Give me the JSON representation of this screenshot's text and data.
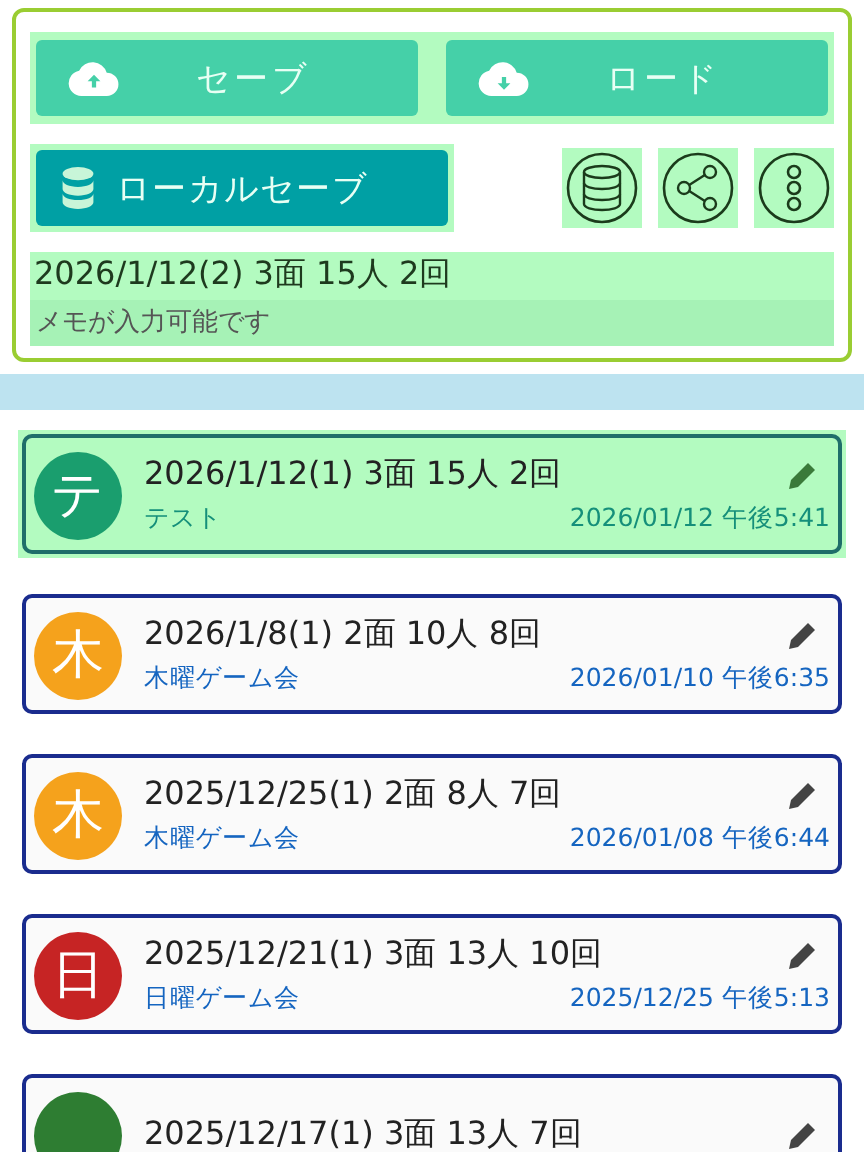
{
  "top_buttons": [
    {
      "label": "セーブ"
    },
    {
      "label": "ロード"
    }
  ],
  "local_save": {
    "label": "ローカルセーブ"
  },
  "current": {
    "title": "2026/1/12(2) 3面 15人 2回",
    "memo": {
      "placeholder": "メモが入力可能です"
    }
  },
  "records": [
    {
      "avatar": "テ",
      "color": "#1a9e6e",
      "title": "2026/1/12(1) 3面 15人 2回",
      "group": "テスト",
      "date": "2026/01/12 午後5:41",
      "selected": true
    },
    {
      "avatar": "木",
      "color": "#f5a21c",
      "title": "2026/1/8(1) 2面 10人 8回",
      "group": "木曜ゲーム会",
      "date": "2026/01/10 午後6:35",
      "selected": false
    },
    {
      "avatar": "木",
      "color": "#f5a21c",
      "title": "2025/12/25(1) 2面 8人 7回",
      "group": "木曜ゲーム会",
      "date": "2026/01/08 午後6:44",
      "selected": false
    },
    {
      "avatar": "日",
      "color": "#c62424",
      "title": "2025/12/21(1) 3面 13人 10回",
      "group": "日曜ゲーム会",
      "date": "2025/12/25 午後5:13",
      "selected": false
    },
    {
      "color": "#2e7d32",
      "title": "2025/12/17(1) 3面 13人 7回",
      "selected": false
    }
  ]
}
